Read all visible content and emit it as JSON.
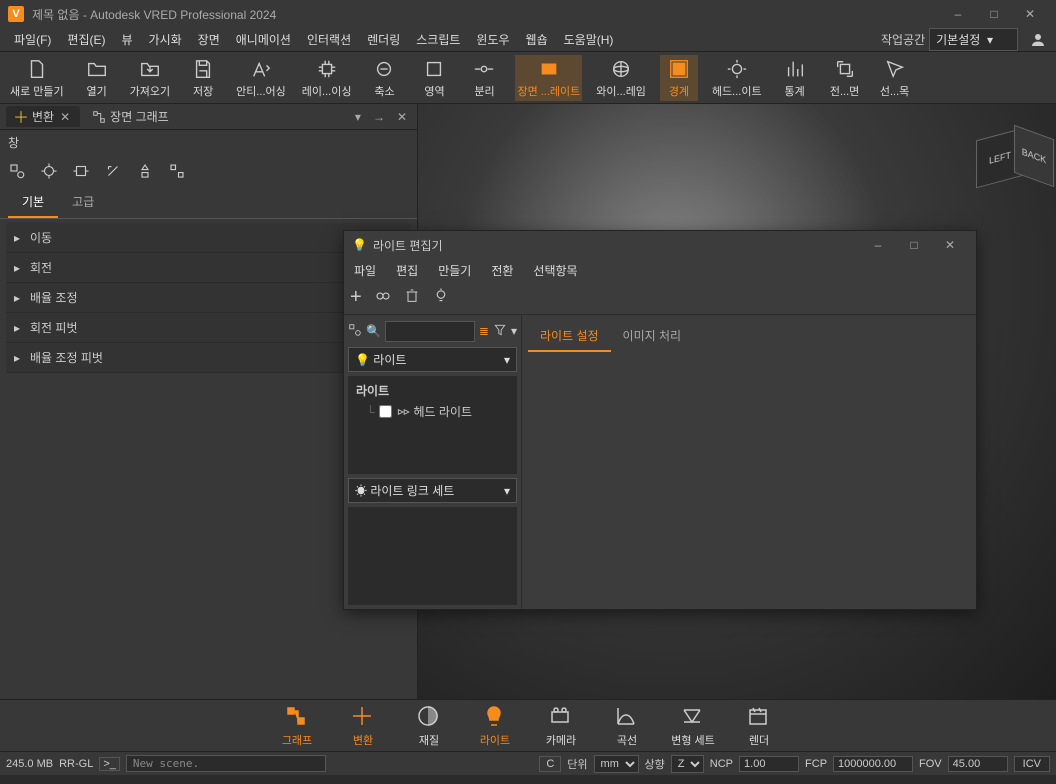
{
  "title": "제목 없음 - Autodesk VRED Professional 2024",
  "menu": [
    "파일(F)",
    "편집(E)",
    "뷰",
    "가시화",
    "장면",
    "애니메이션",
    "인터랙션",
    "렌더링",
    "스크립트",
    "윈도우",
    "웹숍",
    "도움말(H)"
  ],
  "workspace": {
    "label": "작업공간",
    "value": "기본설정"
  },
  "toolbar": [
    {
      "label": "새로 만들기",
      "icon": "file"
    },
    {
      "label": "열기",
      "icon": "folder"
    },
    {
      "label": "가져오기",
      "icon": "import"
    },
    {
      "label": "저장",
      "icon": "save"
    },
    {
      "label": "안티...어싱",
      "icon": "aa"
    },
    {
      "label": "레이...이싱",
      "icon": "cpu"
    },
    {
      "label": "축소",
      "icon": "downscale"
    },
    {
      "label": "영역",
      "icon": "region"
    },
    {
      "label": "분리",
      "icon": "isolate"
    },
    {
      "label": "장면 ...레이트",
      "icon": "plate",
      "active": true
    },
    {
      "label": "와이...레임",
      "icon": "wire"
    },
    {
      "label": "경계",
      "icon": "bound",
      "active": true
    },
    {
      "label": "헤드...이트",
      "icon": "headlight"
    },
    {
      "label": "통계",
      "icon": "stats"
    },
    {
      "label": "전...면",
      "icon": "fullscreen"
    },
    {
      "label": "선...목",
      "icon": "sel"
    }
  ],
  "leftPanel": {
    "tabs": [
      {
        "label": "변환",
        "closable": true
      },
      {
        "label": "장면 그래프",
        "closable": false
      }
    ],
    "sub": "창",
    "subTabs": {
      "basic": "기본",
      "advanced": "고급"
    },
    "accordion": [
      "이동",
      "회전",
      "배율 조정",
      "회전 피벗",
      "배율 조정 피벗"
    ]
  },
  "lightEditor": {
    "title": "라이트 편집기",
    "menu": [
      "파일",
      "편집",
      "만들기",
      "전환",
      "선택항목"
    ],
    "combo": "라이트",
    "treeRoot": "라이트",
    "treeItem": "헤드 라이트",
    "linkCombo": "라이트 링크 세트",
    "rightTabs": {
      "settings": "라이트 설정",
      "image": "이미지 처리"
    }
  },
  "bottomNav": [
    {
      "label": "그래프",
      "active": true
    },
    {
      "label": "변환",
      "active": true
    },
    {
      "label": "재질"
    },
    {
      "label": "라이트",
      "active": true
    },
    {
      "label": "카메라"
    },
    {
      "label": "곡선"
    },
    {
      "label": "변형 세트"
    },
    {
      "label": "렌더"
    }
  ],
  "status": {
    "mem": "245.0 MB",
    "mode": "RR-GL",
    "log": "New scene.",
    "c": "C",
    "unitLabel": "단위",
    "unit": "mm",
    "upLabel": "상향",
    "up": "Z",
    "ncpLabel": "NCP",
    "ncp": "1.00",
    "fcpLabel": "FCP",
    "fcp": "1000000.00",
    "fovLabel": "FOV",
    "fov": "45.00",
    "icv": "ICV"
  },
  "viewCube": {
    "left": "LEFT",
    "back": "BACK"
  }
}
